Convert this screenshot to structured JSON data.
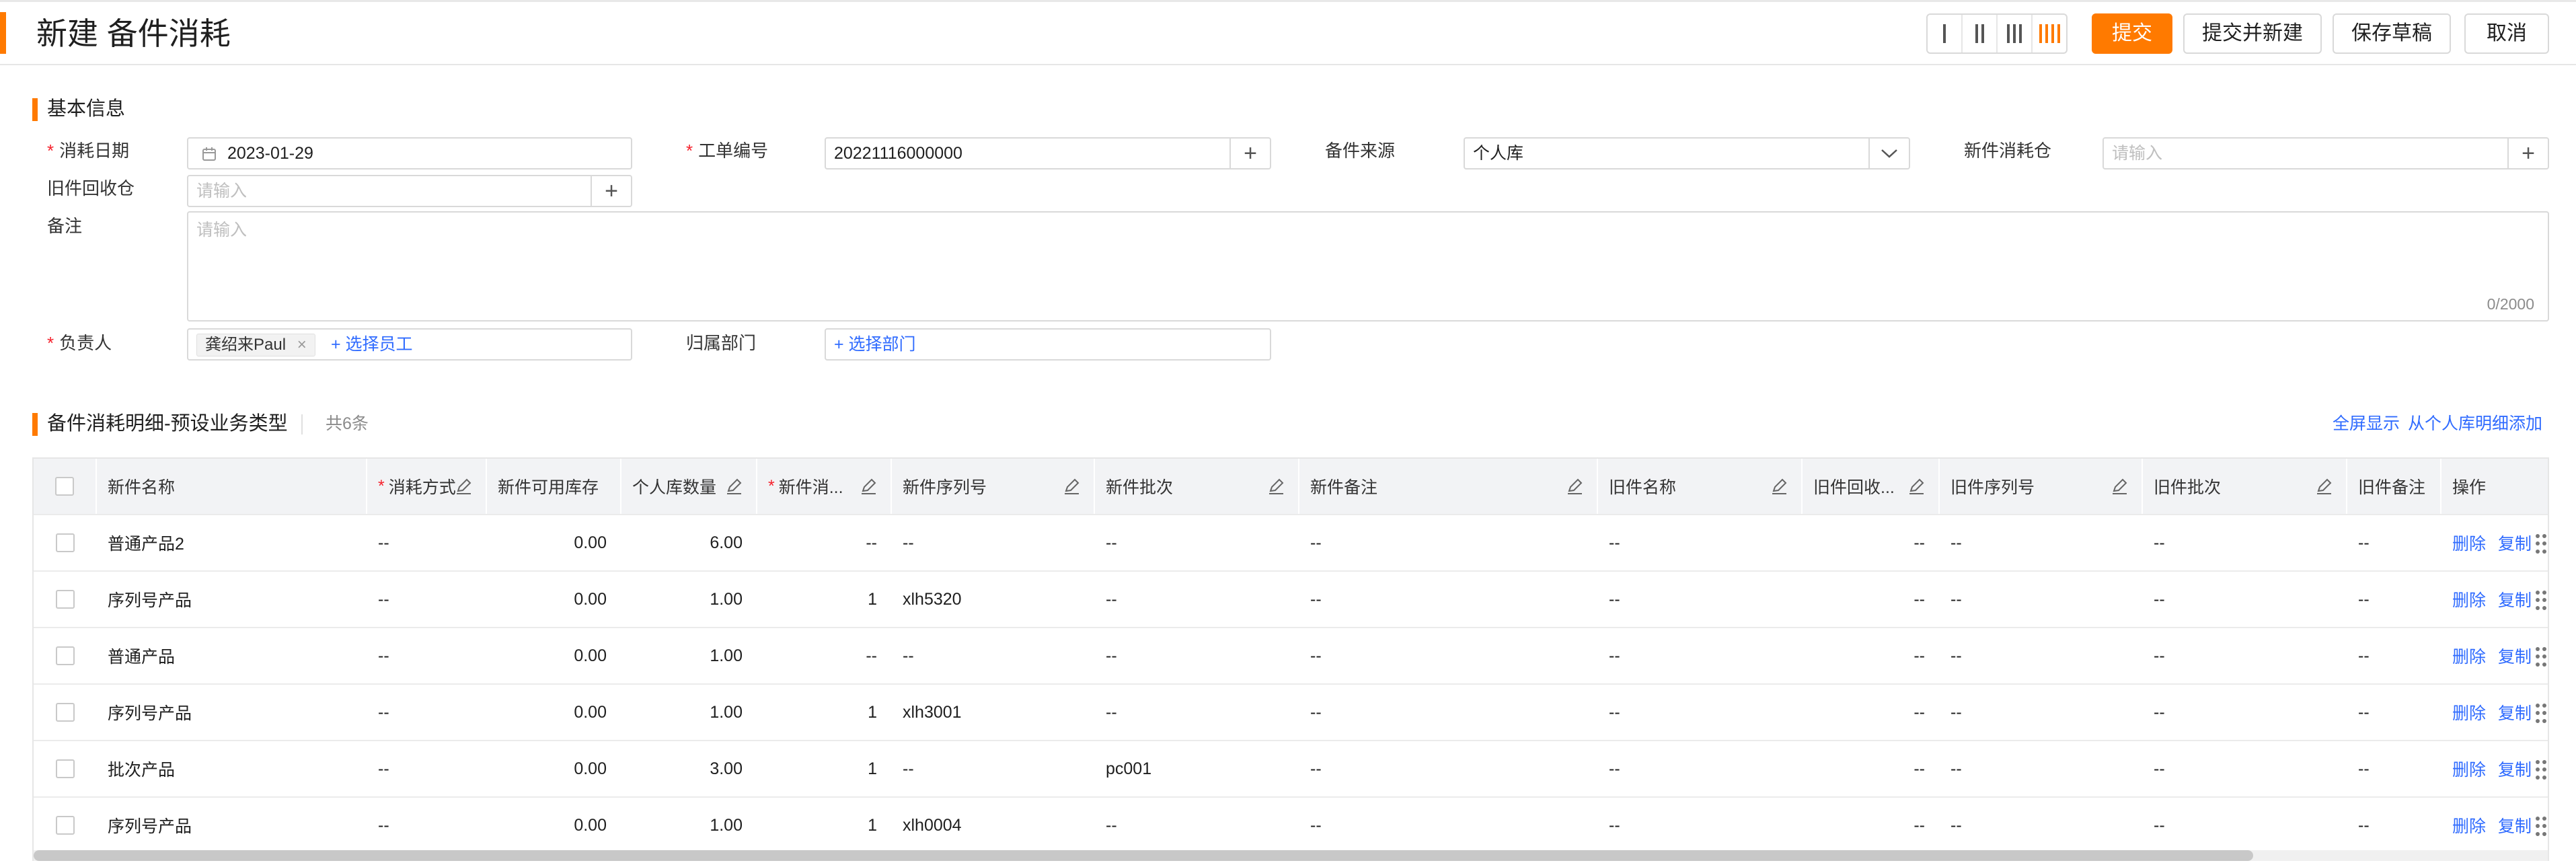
{
  "header": {
    "title": "新建 备件消耗",
    "buttons": {
      "submit": "提交",
      "submit_new": "提交并新建",
      "save_draft": "保存草稿",
      "cancel": "取消"
    },
    "column_layouts": [
      "1",
      "2",
      "3",
      "4"
    ],
    "active_column_layout": "4"
  },
  "basic_info": {
    "title": "基本信息",
    "consume_date": {
      "label": "消耗日期",
      "value": "2023-01-29"
    },
    "work_order": {
      "label": "工单编号",
      "value": "20221116000000"
    },
    "source": {
      "label": "备件来源",
      "value": "个人库"
    },
    "new_warehouse": {
      "label": "新件消耗仓",
      "placeholder": "请输入"
    },
    "old_warehouse": {
      "label": "旧件回收仓",
      "placeholder": "请输入"
    },
    "remark": {
      "label": "备注",
      "placeholder": "请输入",
      "counter": "0/2000"
    },
    "owner": {
      "label": "负责人",
      "tag": "龚绍来Paul",
      "add": "+ 选择员工"
    },
    "department": {
      "label": "归属部门",
      "add": "+ 选择部门"
    }
  },
  "detail": {
    "title": "备件消耗明细-预设业务类型",
    "count": "共6条",
    "fullscreen": "全屏显示",
    "add_from_personal": "从个人库明细添加",
    "columns": [
      "新件名称",
      "消耗方式",
      "新件可用库存",
      "个人库数量",
      "新件消...",
      "新件序列号",
      "新件批次",
      "新件备注",
      "旧件名称",
      "旧件回收...",
      "旧件序列号",
      "旧件批次",
      "旧件备注",
      "操作"
    ],
    "actions": {
      "delete": "删除",
      "copy": "复制"
    },
    "rows": [
      {
        "name": "普通产品2",
        "method": "--",
        "avail": "0.00",
        "personal": "6.00",
        "qty": "--",
        "serial": "--",
        "batch": "--",
        "new_remark": "--",
        "old_name": "--",
        "old_wh": "--",
        "old_serial": "--",
        "old_batch": "--",
        "old_remark": "--"
      },
      {
        "name": "序列号产品",
        "method": "--",
        "avail": "0.00",
        "personal": "1.00",
        "qty": "1",
        "serial": "xlh5320",
        "batch": "--",
        "new_remark": "--",
        "old_name": "--",
        "old_wh": "--",
        "old_serial": "--",
        "old_batch": "--",
        "old_remark": "--"
      },
      {
        "name": "普通产品",
        "method": "--",
        "avail": "0.00",
        "personal": "1.00",
        "qty": "--",
        "serial": "--",
        "batch": "--",
        "new_remark": "--",
        "old_name": "--",
        "old_wh": "--",
        "old_serial": "--",
        "old_batch": "--",
        "old_remark": "--"
      },
      {
        "name": "序列号产品",
        "method": "--",
        "avail": "0.00",
        "personal": "1.00",
        "qty": "1",
        "serial": "xlh3001",
        "batch": "--",
        "new_remark": "--",
        "old_name": "--",
        "old_wh": "--",
        "old_serial": "--",
        "old_batch": "--",
        "old_remark": "--"
      },
      {
        "name": "批次产品",
        "method": "--",
        "avail": "0.00",
        "personal": "3.00",
        "qty": "1",
        "serial": "--",
        "batch": "pc001",
        "new_remark": "--",
        "old_name": "--",
        "old_wh": "--",
        "old_serial": "--",
        "old_batch": "--",
        "old_remark": "--"
      },
      {
        "name": "序列号产品",
        "method": "--",
        "avail": "0.00",
        "personal": "1.00",
        "qty": "1",
        "serial": "xlh0004",
        "batch": "--",
        "new_remark": "--",
        "old_name": "--",
        "old_wh": "--",
        "old_serial": "--",
        "old_batch": "--",
        "old_remark": "--"
      }
    ]
  },
  "colors": {
    "accent": "#ff7a00",
    "link": "#2f6bff",
    "required": "#f5222d"
  }
}
